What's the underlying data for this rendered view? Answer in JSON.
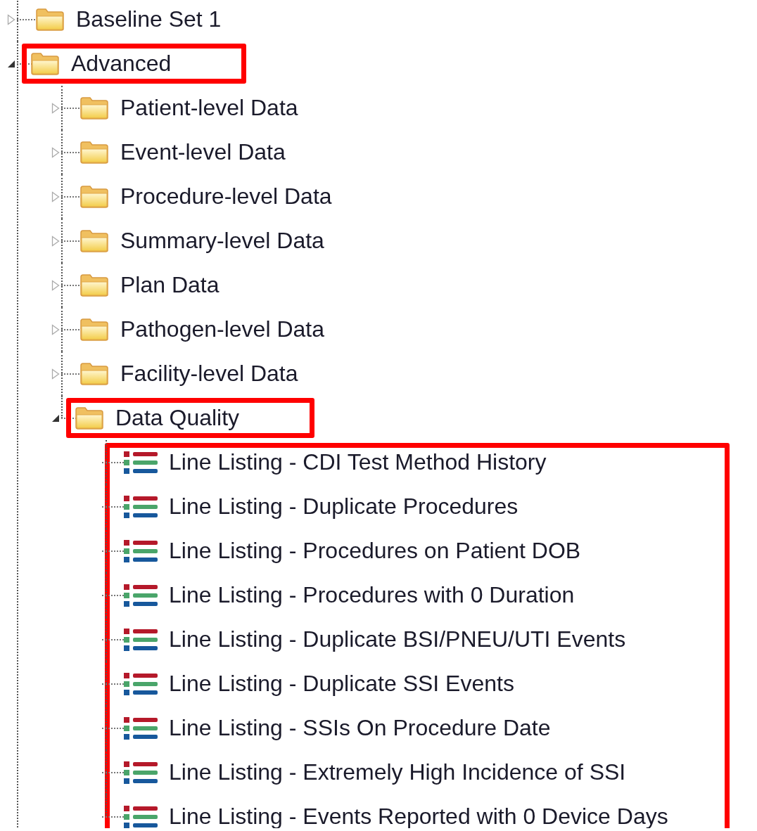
{
  "tree": [
    {
      "kind": "folder",
      "label": "Baseline Set 1",
      "expanded": false,
      "highlighted": false
    },
    {
      "kind": "folder",
      "label": "Advanced",
      "expanded": true,
      "highlighted": true,
      "children": [
        {
          "kind": "folder",
          "label": "Patient-level Data",
          "expanded": false,
          "highlighted": false
        },
        {
          "kind": "folder",
          "label": "Event-level Data",
          "expanded": false,
          "highlighted": false
        },
        {
          "kind": "folder",
          "label": "Procedure-level Data",
          "expanded": false,
          "highlighted": false
        },
        {
          "kind": "folder",
          "label": "Summary-level Data",
          "expanded": false,
          "highlighted": false
        },
        {
          "kind": "folder",
          "label": "Plan Data",
          "expanded": false,
          "highlighted": false
        },
        {
          "kind": "folder",
          "label": "Pathogen-level Data",
          "expanded": false,
          "highlighted": false
        },
        {
          "kind": "folder",
          "label": "Facility-level Data",
          "expanded": false,
          "highlighted": false
        },
        {
          "kind": "folder",
          "label": "Data Quality",
          "expanded": true,
          "highlighted": true,
          "children_highlighted": true,
          "children": [
            {
              "kind": "report",
              "label": "Line Listing - CDI Test Method History"
            },
            {
              "kind": "report",
              "label": "Line Listing - Duplicate Procedures"
            },
            {
              "kind": "report",
              "label": "Line Listing - Procedures on Patient DOB"
            },
            {
              "kind": "report",
              "label": "Line Listing - Procedures with 0 Duration"
            },
            {
              "kind": "report",
              "label": "Line Listing - Duplicate BSI/PNEU/UTI Events"
            },
            {
              "kind": "report",
              "label": "Line Listing - Duplicate SSI Events"
            },
            {
              "kind": "report",
              "label": "Line Listing - SSIs On Procedure Date"
            },
            {
              "kind": "report",
              "label": "Line Listing - Extremely High Incidence of SSI"
            },
            {
              "kind": "report",
              "label": "Line Listing - Events Reported with 0 Device Days"
            }
          ]
        }
      ]
    }
  ]
}
